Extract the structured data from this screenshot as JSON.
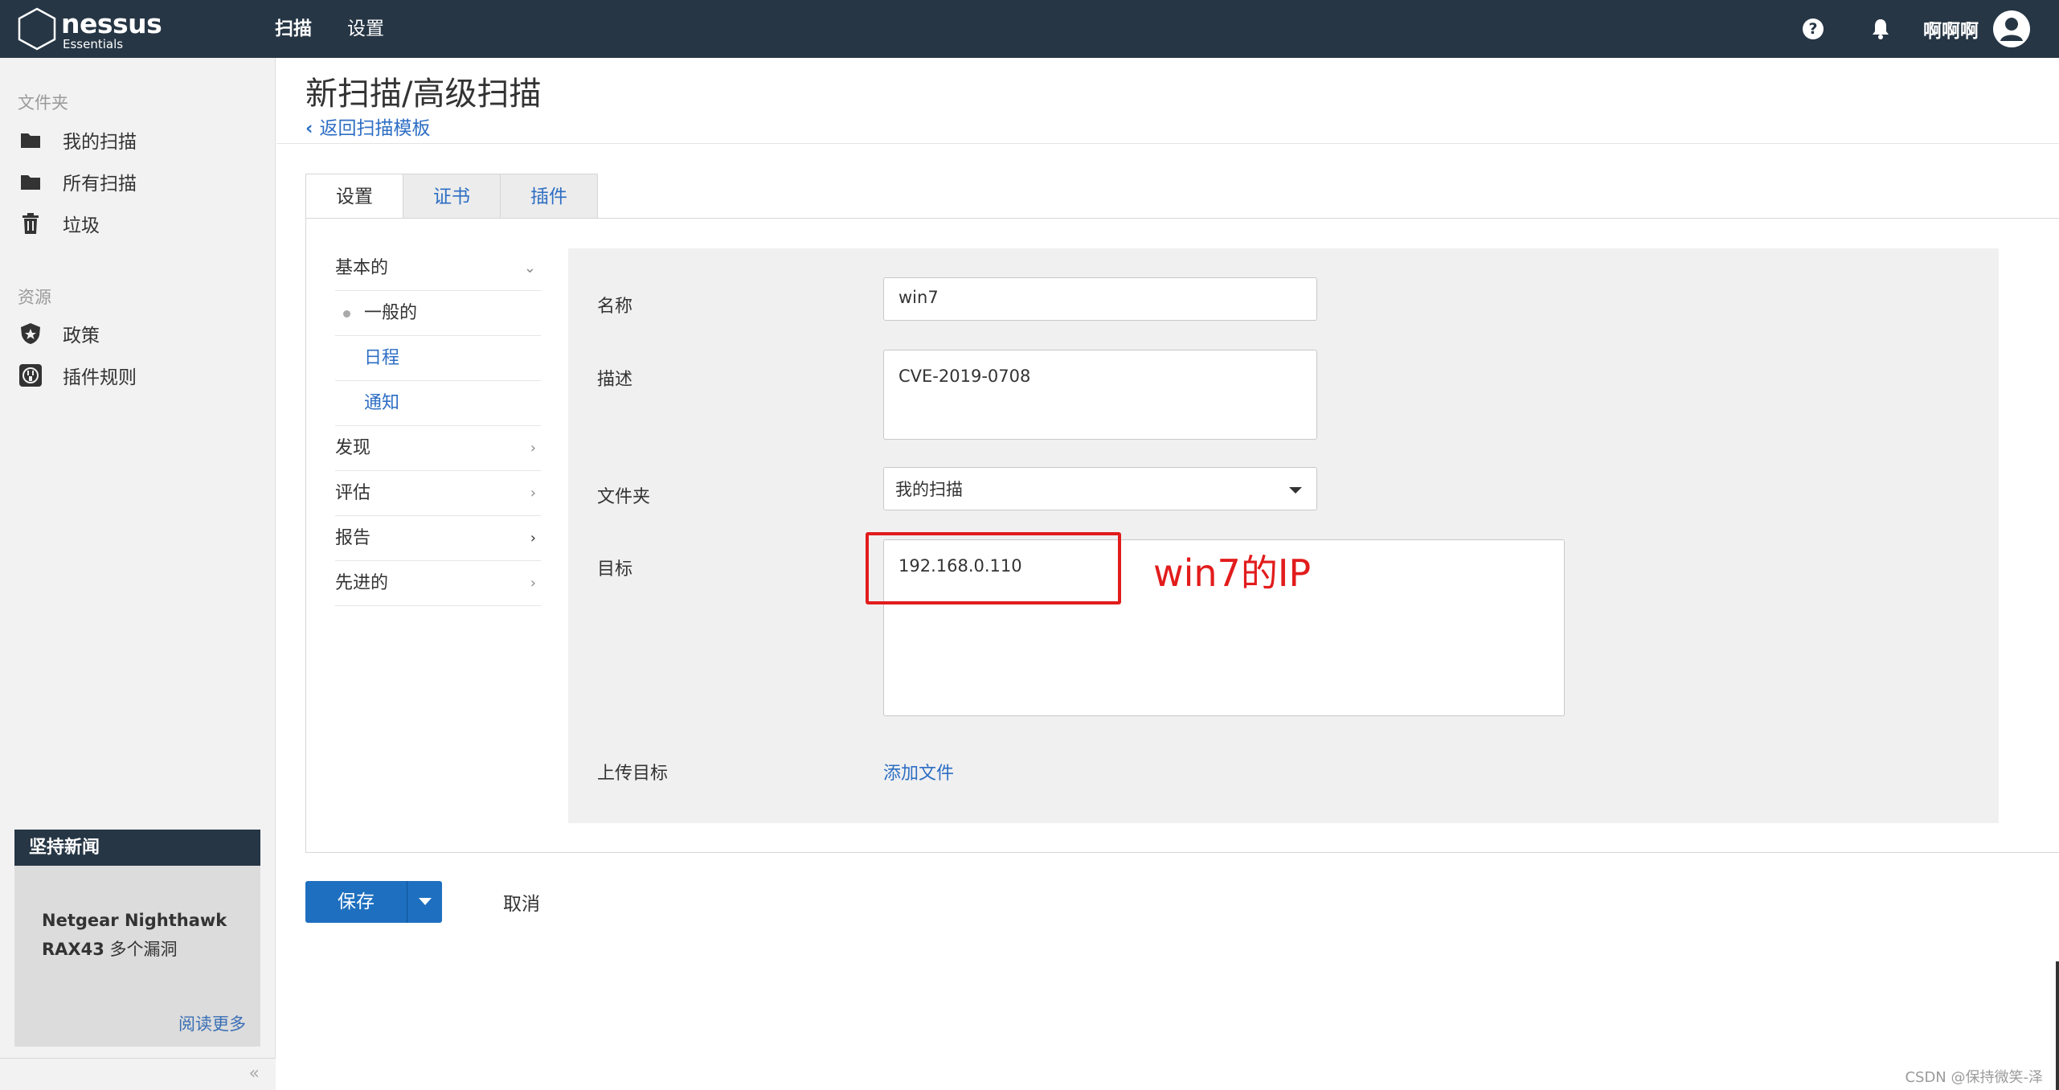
{
  "topbar": {
    "logo": {
      "name": "nessus",
      "sub": "Essentials"
    },
    "nav": [
      {
        "label": "扫描",
        "active": true
      },
      {
        "label": "设置",
        "active": false
      }
    ],
    "user_name": "啊啊啊",
    "icons": [
      "help-icon",
      "bell-icon",
      "user-avatar-icon"
    ]
  },
  "sidebar": {
    "folders_heading": "文件夹",
    "folders": [
      {
        "label": "我的扫描",
        "icon": "folder-icon"
      },
      {
        "label": "所有扫描",
        "icon": "folder-icon"
      },
      {
        "label": "垃圾",
        "icon": "trash-icon"
      }
    ],
    "resources_heading": "资源",
    "resources": [
      {
        "label": "政策",
        "icon": "shield-icon"
      },
      {
        "label": "插件规则",
        "icon": "plugin-icon"
      }
    ],
    "news": {
      "heading": "坚持新闻",
      "bold_line1": "Netgear Nighthawk",
      "bold_line2": "RAX43",
      "rest_line2": " 多个漏洞",
      "read_more": "阅读更多"
    },
    "collapse_glyph": "«"
  },
  "page": {
    "title": "新扫描/高级扫描",
    "back_link": "返回扫描模板",
    "tabs": [
      {
        "label": "设置",
        "active": true
      },
      {
        "label": "证书",
        "active": false
      },
      {
        "label": "插件",
        "active": false
      }
    ]
  },
  "subnav": {
    "basic": "基本的",
    "general": "一般的",
    "schedule": "日程",
    "notify": "通知",
    "discovery": "发现",
    "assessment": "评估",
    "report": "报告",
    "advanced": "先进的"
  },
  "form": {
    "name_label": "名称",
    "name_value": "win7",
    "desc_label": "描述",
    "desc_value": "CVE-2019-0708",
    "folder_label": "文件夹",
    "folder_value": "我的扫描",
    "target_label": "目标",
    "target_value": "192.168.0.110",
    "upload_label": "上传目标",
    "add_file": "添加文件"
  },
  "annotation": {
    "text": "win7的IP",
    "color": "#e21c1c"
  },
  "actions": {
    "save": "保存",
    "cancel": "取消"
  },
  "watermark": "CSDN @保持微笑-泽",
  "colors": {
    "topbar": "#263645",
    "link": "#2d6ec4",
    "primary_button": "#1e6fbf"
  }
}
